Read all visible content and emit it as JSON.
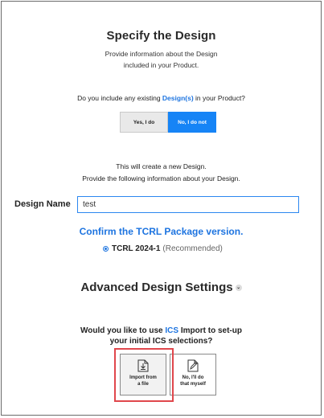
{
  "header": {
    "title": "Specify the Design",
    "subtitle_line1": "Provide information about the Design",
    "subtitle_line2": "included in your Product."
  },
  "existing_design": {
    "question_prefix": "Do you include any existing ",
    "question_link": "Design(s)",
    "question_suffix": " in your Product?",
    "yes_label": "Yes, I do",
    "no_label": "No, I do not",
    "selected": "No, I do not"
  },
  "info": {
    "line1": "This will create a new Design.",
    "line2": "Provide the following information about your Design."
  },
  "design_name": {
    "label": "Design Name",
    "value": "test"
  },
  "package": {
    "heading": "Confirm the TCRL Package version.",
    "option_label": "TCRL 2024-1",
    "option_note": "(Recommended)",
    "selected": true
  },
  "advanced": {
    "title": "Advanced Design Settings",
    "toggle_glyph": "⌄"
  },
  "ics": {
    "question_prefix": "Would you like to use ",
    "question_link": "ICS",
    "question_suffix": " Import to set-up",
    "question_line2": "your initial ICS selections?",
    "import_line1": "Import from",
    "import_line2": "a file",
    "manual_line1": "No, I'll do",
    "manual_line2": "that myself"
  },
  "colors": {
    "accent": "#1d74e0",
    "primary_button": "#1684f6",
    "highlight": "#e0474c"
  }
}
